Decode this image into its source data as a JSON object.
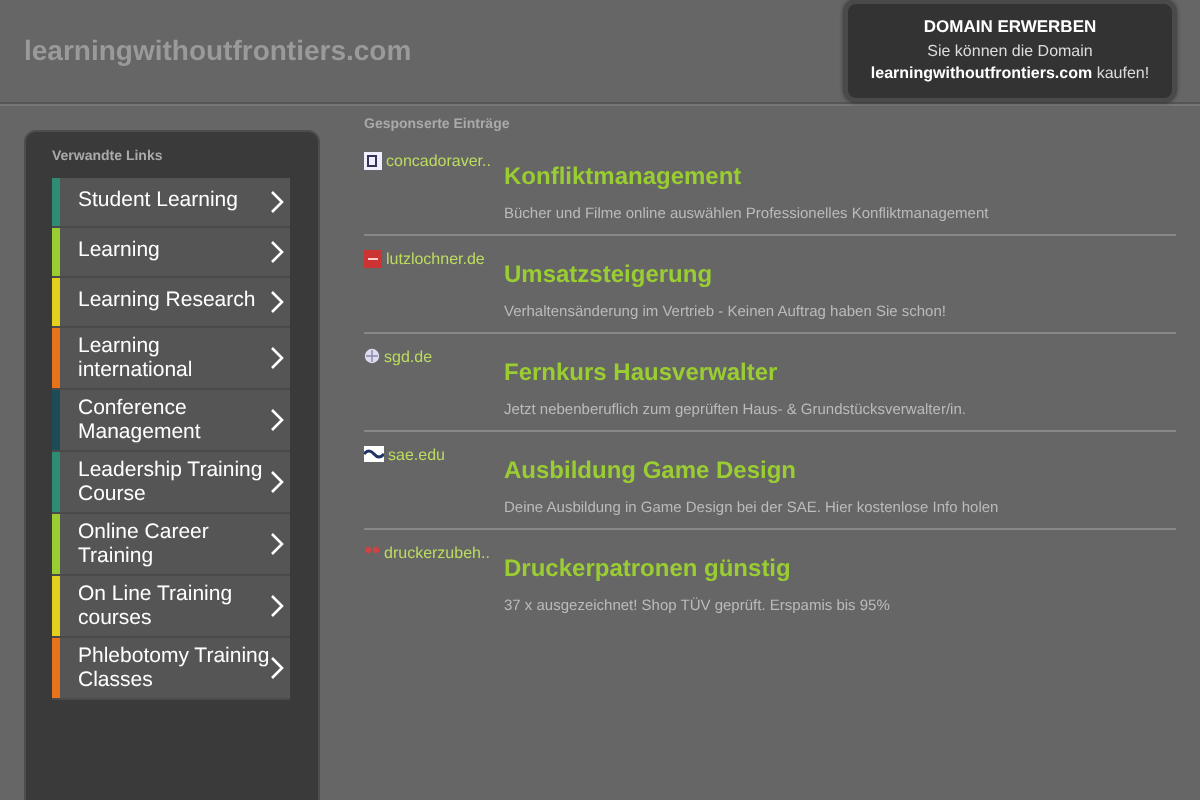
{
  "site_title": "learningwithoutfrontiers.com",
  "domain_offer": {
    "heading": "DOMAIN ERWERBEN",
    "line_1": "Sie können die Domain",
    "domain": "learningwithoutfrontiers.com",
    "line_2_suffix": "kaufen!"
  },
  "related_links": {
    "heading": "Verwandte Links",
    "items": [
      {
        "label": "Student Learning",
        "color": "#2e8b74"
      },
      {
        "label": "Learning",
        "color": "#9acd32"
      },
      {
        "label": "Learning Research",
        "color": "#e2cf1e"
      },
      {
        "label": "Learning international",
        "color": "#e8731a"
      },
      {
        "label": "Conference Management",
        "color": "#1d4b57"
      },
      {
        "label": "Leadership Training Course",
        "color": "#2e8b74"
      },
      {
        "label": "Online Career Training",
        "color": "#9acd32"
      },
      {
        "label": "On Line Training courses",
        "color": "#e2cf1e"
      },
      {
        "label": "Phlebotomy Training Classes",
        "color": "#e8731a"
      }
    ]
  },
  "sponsored": {
    "heading": "Gesponserte Einträge",
    "ads": [
      {
        "kind": "page",
        "domain": "concadoraver..",
        "title": "Konfliktmanagement",
        "description": "Bücher und Filme online auswählen Professionelles Konfliktmanagement"
      },
      {
        "kind": "redbox",
        "domain": "lutzlochner.de",
        "title": "Umsatzsteigerung",
        "description": "Verhaltensänderung im Vertrieb - Keinen Auftrag haben Sie schon!"
      },
      {
        "kind": "globe",
        "domain": "sgd.de",
        "title": "Fernkurs Hausverwalter",
        "description": "Jetzt nebenberuflich zum geprüften Haus- & Grundstücksverwalter/in."
      },
      {
        "kind": "wave",
        "domain": "sae.edu",
        "title": "Ausbildung Game Design",
        "description": "Deine Ausbildung in Game Design bei der SAE. Hier kostenlose Info holen"
      },
      {
        "kind": "dots",
        "domain": "druckerzubeh..",
        "title": "Druckerpatronen günstig",
        "description": "37 x ausgezeichnet! Shop TÜV geprüft. Erspamis bis 95%"
      }
    ]
  }
}
